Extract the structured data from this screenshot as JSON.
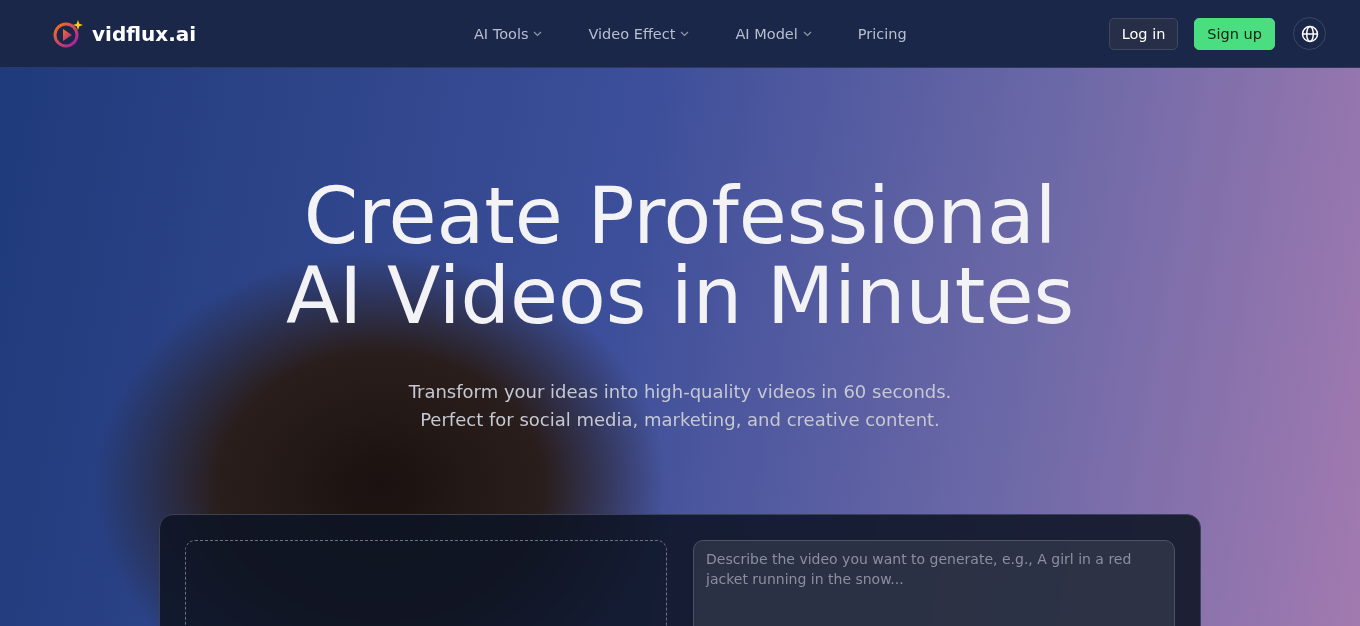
{
  "header": {
    "logo": "vidflux.ai",
    "nav": [
      {
        "label": "AI Tools",
        "dropdown": true
      },
      {
        "label": "Video Effect",
        "dropdown": true
      },
      {
        "label": "AI Model",
        "dropdown": true
      },
      {
        "label": "Pricing",
        "dropdown": false
      }
    ],
    "login": "Log in",
    "signup": "Sign up"
  },
  "hero": {
    "title_lines": [
      "Create Professional",
      "AI Videos in Minutes"
    ],
    "subtitle_lines": [
      "Transform your ideas into high-quality videos in 60 seconds.",
      "Perfect for social media, marketing, and creative content."
    ]
  },
  "generator": {
    "prompt": {
      "placeholder": "Describe the video you want to generate, e.g., A girl in a red jacket running in the snow..."
    }
  }
}
